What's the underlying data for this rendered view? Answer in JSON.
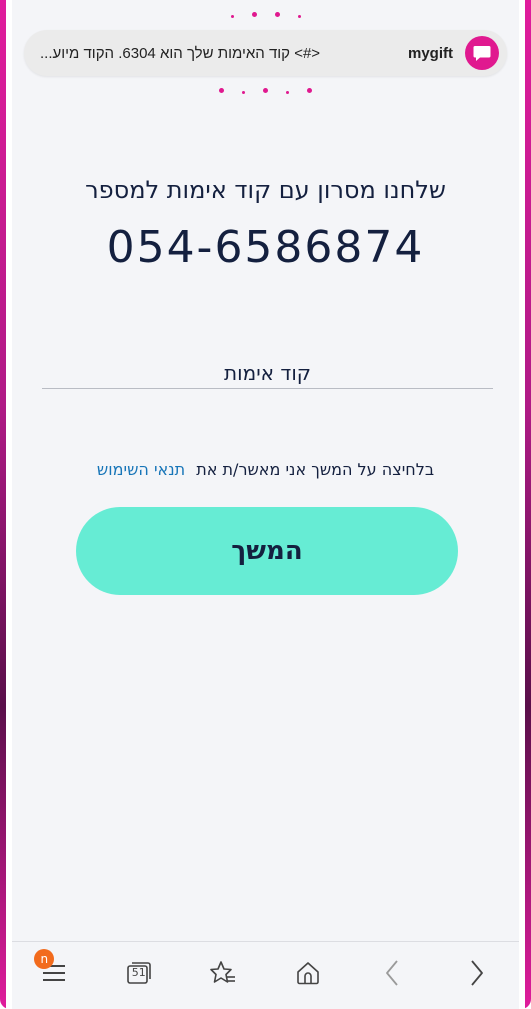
{
  "notification": {
    "app_name": "mygift",
    "message": "<#> קוד האימות שלך הוא 6304. הקוד מיוע...",
    "icon": "message-bubble-icon",
    "accent_color": "#e0198f"
  },
  "verification": {
    "heading": "שלחנו מסרון עם קוד אימות למספר",
    "phone_number": "054-6586874",
    "code_placeholder": "קוד אימות",
    "terms_prefix": "בלחיצה על המשך אני מאשר/ת את",
    "terms_link": "תנאי השימוש",
    "continue_label": "המשך",
    "button_color": "#66ecd4",
    "text_color": "#14203f",
    "link_color": "#1775b8"
  },
  "browser_bar": {
    "menu_badge": "n",
    "tab_count": "51",
    "icons": [
      "menu-icon",
      "tabs-icon",
      "bookmarks-icon",
      "home-icon",
      "back-icon",
      "forward-icon"
    ]
  }
}
